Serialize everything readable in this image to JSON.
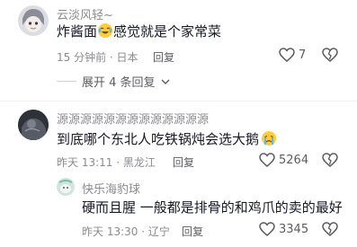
{
  "comments": [
    {
      "username": "云淡风轻~",
      "text_before": "炸酱面",
      "text_after": "感觉就是个家常菜",
      "time_location": "15 分钟前 · 日本",
      "reply_label": "回复",
      "likes": "7",
      "expand_label": "展开 4 条回复"
    },
    {
      "username": "源源源源源源源源源源源源源",
      "text_before": "到底哪个东北人吃铁锅炖会选大鹅",
      "text_after": "",
      "time_location": "昨天 13:11 · 黑龙江",
      "reply_label": "回复",
      "likes": "5264"
    },
    {
      "username": "快乐海豹球",
      "text_before": "硬而且腥 一般都是排骨的和鸡爪的卖的最好",
      "text_after": "",
      "time_location": "昨天 13:30 · 辽宁",
      "reply_label": "回复",
      "likes": "3345"
    }
  ],
  "colors": {
    "text": "#161823",
    "meta": "#8a8b91",
    "divider": "#efeff1"
  }
}
